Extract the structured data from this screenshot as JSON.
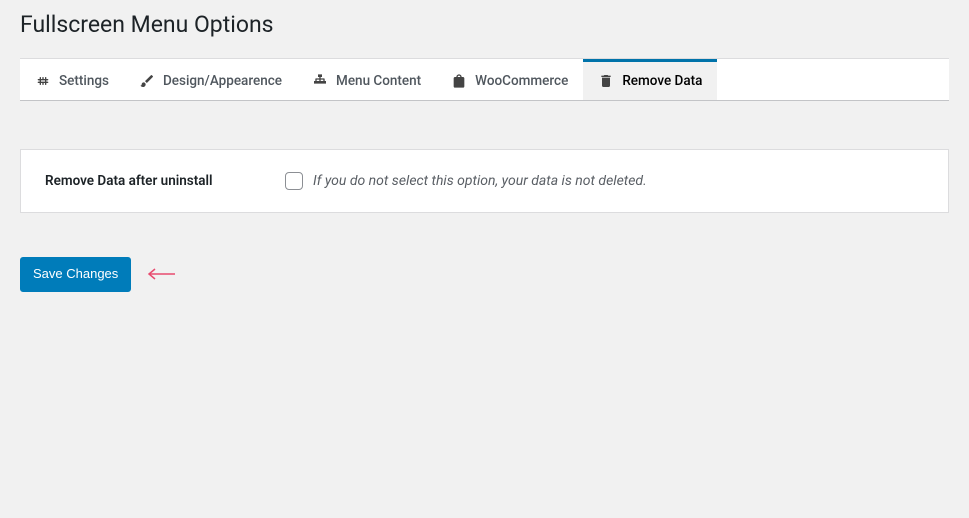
{
  "page": {
    "title": "Fullscreen Menu Options"
  },
  "tabs": [
    {
      "label": "Settings",
      "icon": "settings-icon"
    },
    {
      "label": "Design/Appearence",
      "icon": "brush-icon"
    },
    {
      "label": "Menu Content",
      "icon": "sitemap-icon"
    },
    {
      "label": "WooCommerce",
      "icon": "bag-icon"
    },
    {
      "label": "Remove Data",
      "icon": "trash-icon",
      "active": true
    }
  ],
  "form": {
    "remove_data": {
      "label": "Remove Data after uninstall",
      "description": "If you do not select this option, your data is not deleted.",
      "checked": false
    },
    "submit_label": "Save Changes"
  }
}
